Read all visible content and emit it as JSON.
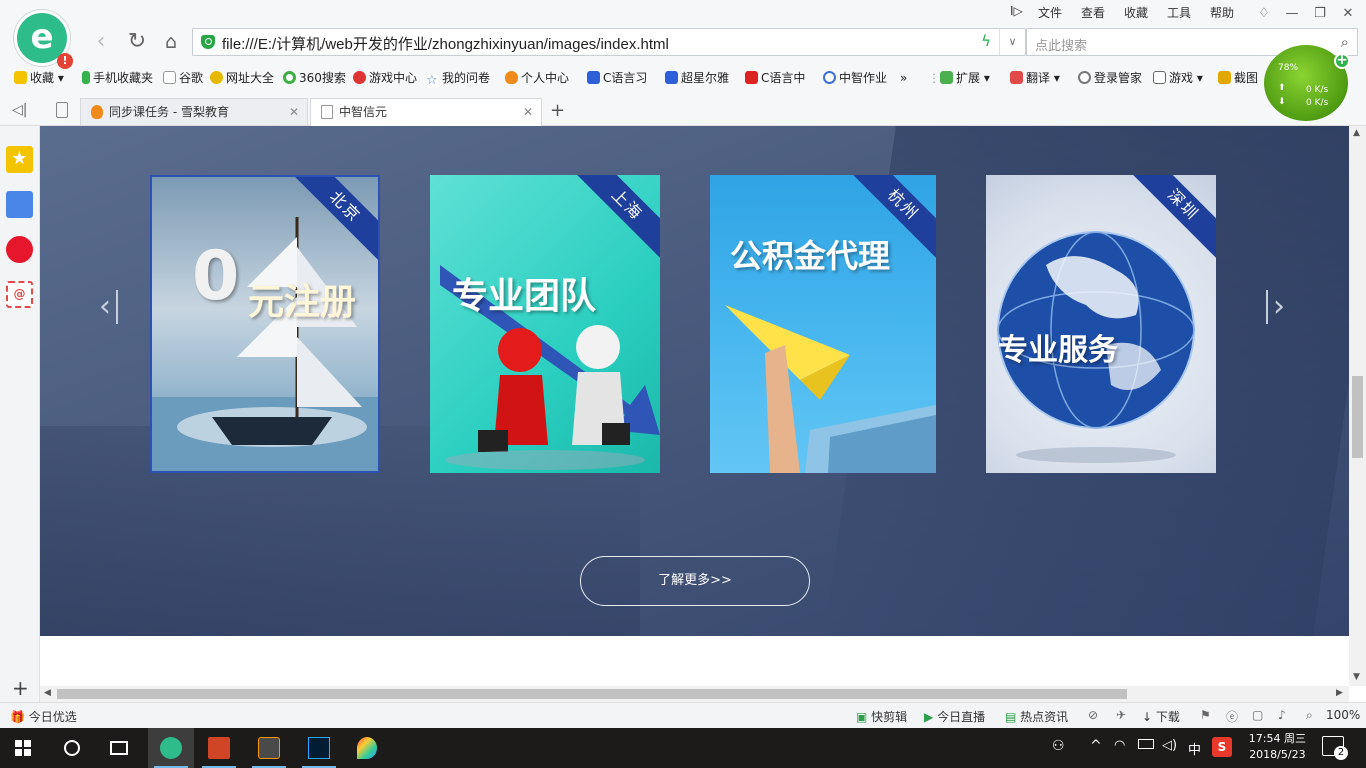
{
  "menu": [
    "文件",
    "查看",
    "收藏",
    "工具",
    "帮助"
  ],
  "address": {
    "url": "file:///E:/计算机/web开发的作业/zhongzhixinyuan/images/index.html",
    "search_placeholder": "点此搜索"
  },
  "bookmarks": [
    "收藏",
    "手机收藏夹",
    "谷歌",
    "网址大全",
    "360搜索",
    "游戏中心",
    "我的问卷",
    "个人中心",
    "C语言习",
    "超星尔雅",
    "C语言中",
    "中智作业",
    "扩展",
    "翻译",
    "登录管家",
    "游戏",
    "截图"
  ],
  "tabs": [
    {
      "title": "同步课任务 - 雪梨教育",
      "active": false
    },
    {
      "title": "中智信元",
      "active": true
    }
  ],
  "speed": {
    "percent": "78%",
    "up": "0 K/s",
    "down": "0 K/s"
  },
  "carousel": {
    "cards": [
      {
        "city": "北京",
        "big_digit": "0",
        "caption": "元注册"
      },
      {
        "city": "上海",
        "caption": "专业团队"
      },
      {
        "city": "杭州",
        "caption": "公积金代理"
      },
      {
        "city": "深圳",
        "caption": "专业服务"
      }
    ],
    "more_button": "了解更多>>"
  },
  "status": {
    "left": "今日优选",
    "items": [
      "快剪辑",
      "今日直播",
      "热点资讯",
      "下载"
    ],
    "zoom": "100%"
  },
  "taskbar": {
    "time": "17:54 周三",
    "date": "2018/5/23",
    "ime": "中",
    "notif_count": "2"
  },
  "colors": {
    "banner": "#4a5b7e",
    "ribbon": "#1f3f9c",
    "accent_green": "#2ebd8a"
  }
}
